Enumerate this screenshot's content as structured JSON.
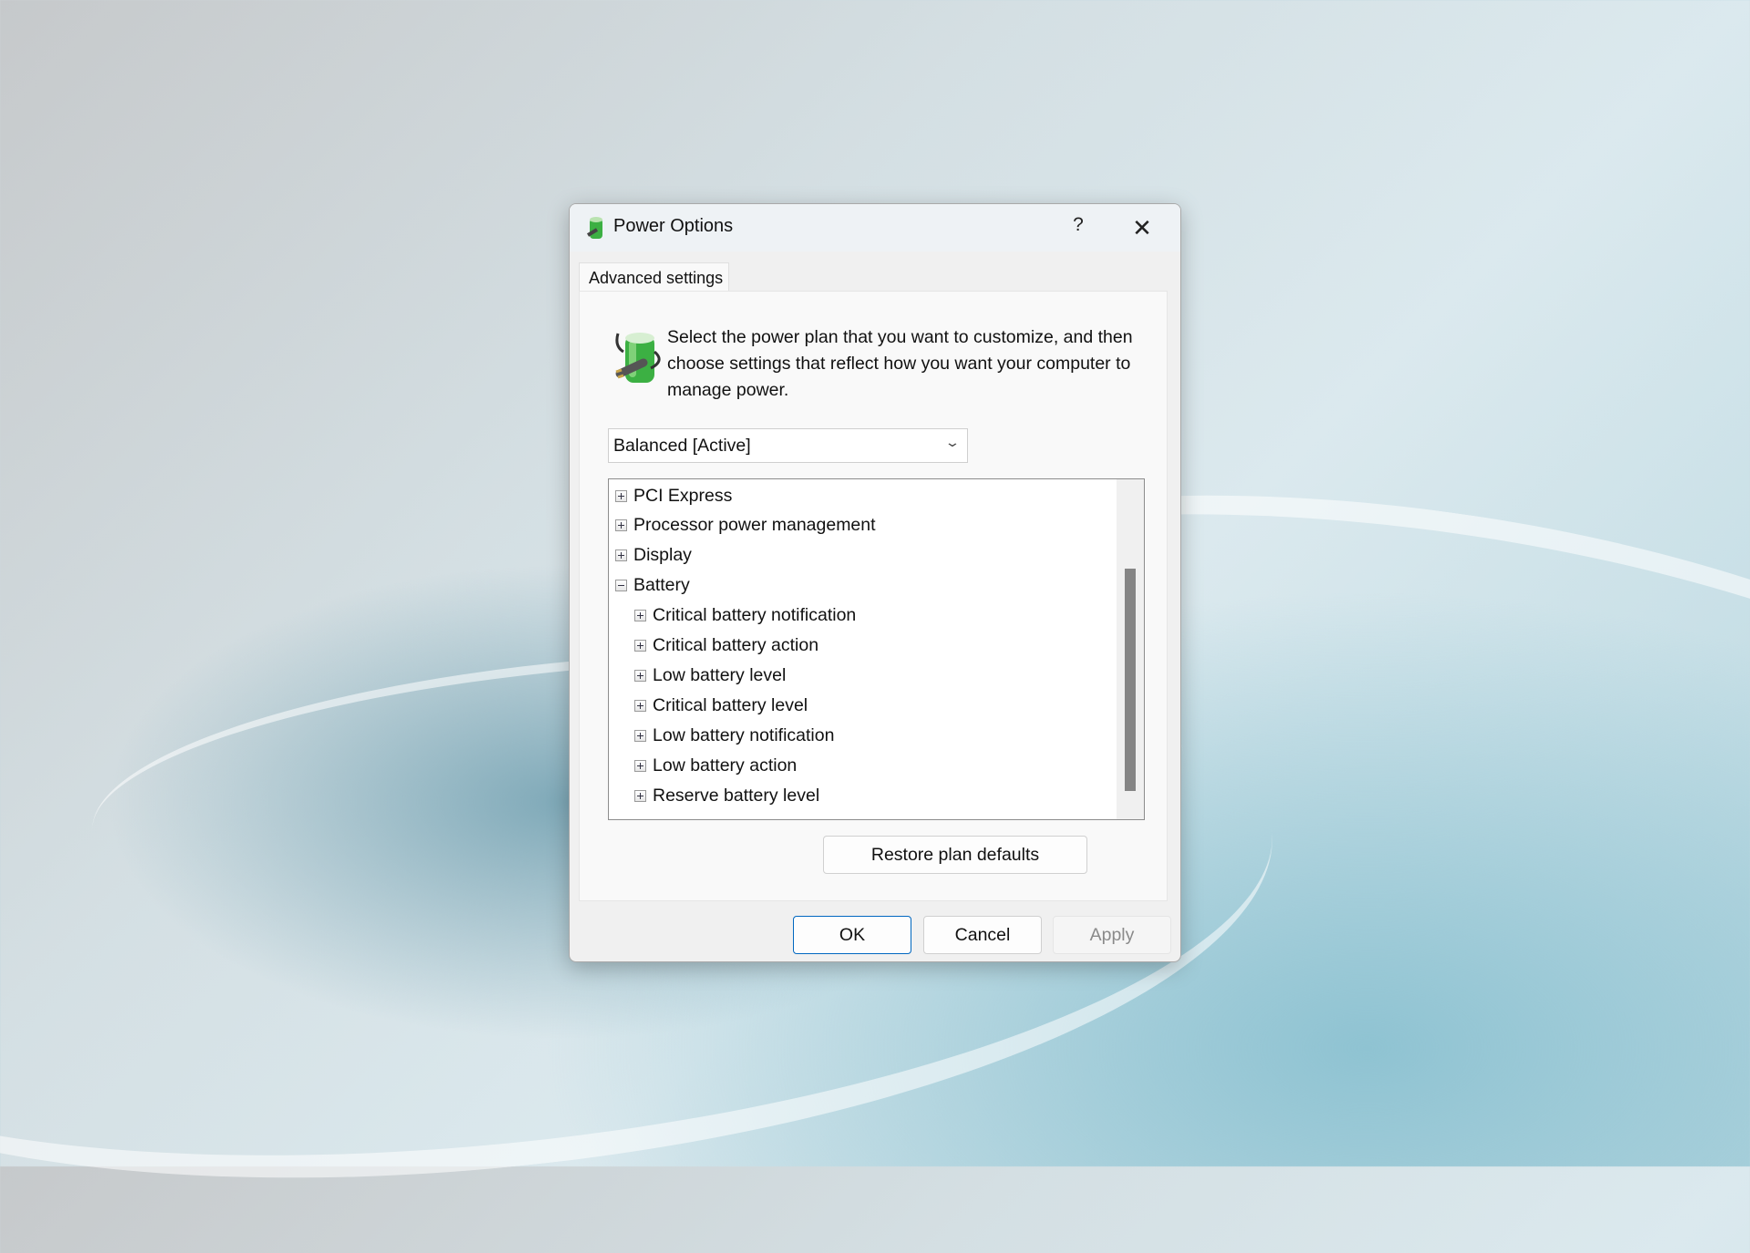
{
  "window": {
    "title": "Power Options",
    "help_label": "?",
    "close_icon": "close-icon"
  },
  "tab": {
    "label": "Advanced settings"
  },
  "description": "Select the power plan that you want to customize, and then choose settings that reflect how you want your computer to manage power.",
  "plan_select": {
    "value": "Balanced [Active]"
  },
  "tree": {
    "items": [
      {
        "label": "PCI Express",
        "state": "collapsed",
        "level": 0
      },
      {
        "label": "Processor power management",
        "state": "collapsed",
        "level": 0
      },
      {
        "label": "Display",
        "state": "collapsed",
        "level": 0
      },
      {
        "label": "Battery",
        "state": "expanded",
        "level": 0
      },
      {
        "label": "Critical battery notification",
        "state": "collapsed",
        "level": 1
      },
      {
        "label": "Critical battery action",
        "state": "collapsed",
        "level": 1
      },
      {
        "label": "Low battery level",
        "state": "collapsed",
        "level": 1
      },
      {
        "label": "Critical battery level",
        "state": "collapsed",
        "level": 1
      },
      {
        "label": "Low battery notification",
        "state": "collapsed",
        "level": 1
      },
      {
        "label": "Low battery action",
        "state": "collapsed",
        "level": 1
      },
      {
        "label": "Reserve battery level",
        "state": "collapsed",
        "level": 1
      }
    ]
  },
  "buttons": {
    "restore": "Restore plan defaults",
    "ok": "OK",
    "cancel": "Cancel",
    "apply": "Apply"
  },
  "colors": {
    "accent": "#0067c0",
    "battery_green": "#3cb043"
  }
}
